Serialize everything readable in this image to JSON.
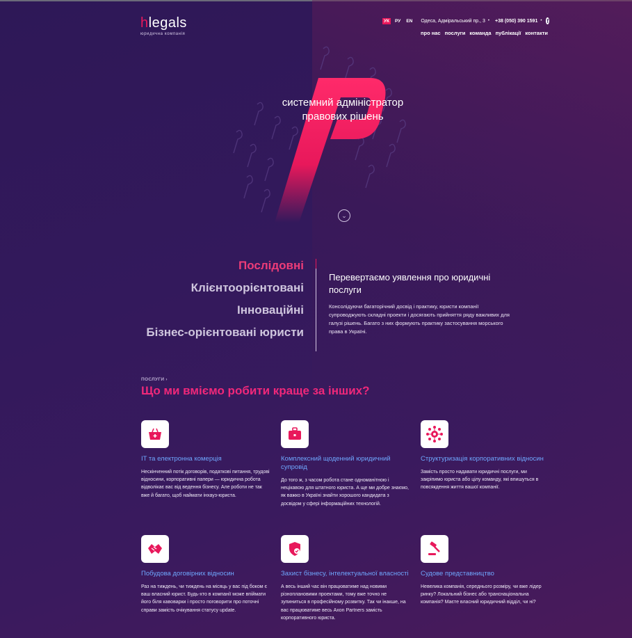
{
  "header": {
    "logo_h": "h",
    "logo_rest": "legals",
    "logo_sub": "юридична компанія",
    "languages": [
      "УК",
      "РУ",
      "EN"
    ],
    "address": "Одеса, Адміральський пр., 3",
    "phone": "+38 (050) 390 1591",
    "social_icon": "facebook-icon",
    "nav": [
      "про нас",
      "послуги",
      "команда",
      "публікації",
      "контакти"
    ]
  },
  "hero": {
    "title_line1": "системний адміністратор",
    "title_line2": "правових рішень",
    "scroll_icon": "chevron-down-icon"
  },
  "about": {
    "values": [
      "Послідовні",
      "Клієнтоорієнтовані",
      "Інноваційні",
      "Бізнес-орієнтовані юристи"
    ],
    "title": "Перевертаємо уявлення про юридичні послуги",
    "text": "Консолідуючи багаторічний досвід і практику, юристи компанії супроводжують складні проекти і досягають прийняття ряду важливих для галузі рішень. Багато з них формують практику застосування морського права в Україні."
  },
  "services": {
    "crumb": "ПОСЛУГИ ›",
    "title": "Що ми вміємо робити краще за інших?",
    "items": [
      {
        "icon": "shopping-basket-icon",
        "title": "IT та електронна комерція",
        "text": "Нескінченний потік договорів, податкові питання, трудові відносини, корпоративні папери — юридична робота відволікає вас від ведення бізнесу. Але роботи не так вже й багато, щоб наймати інхауз-юриста."
      },
      {
        "icon": "briefcase-icon",
        "title": "Комплексний щоденний юридичний супровід",
        "text": "До того ж, з часом робота стане одноманітною і нецікавою для штатного юриста. А ще ми добре знаємо, як важко в Україні знайти хорошого кандидата з досвідом у сфері інформаційних технологій."
      },
      {
        "icon": "network-icon",
        "title": "Структуризація корпоративних відносин",
        "text": "Замість просто надавати юридичні послуги, ми закріпимо юриста або цілу команду, які впишуться в повсякдення життя вашої компанії."
      },
      {
        "icon": "handshake-icon",
        "title": "Побудова договірних відносин",
        "text": "Раз на тиждень, чи тиждень на місяць у вас під боком є ваш власний юрист. Будь-хто в компанії може впіймати його біля кавоварки і просто поговорити про поточні справи замість очікування статусу update."
      },
      {
        "icon": "shield-check-icon",
        "title": "Захист бізнесу, інтелектуальної власності",
        "text": "А весь інший час він працюватиме над новими різноплановими проектами, тому вже точно не зупиниться в професійному розвитку. Так чи інакше, на вас працюватиме весь Axon Partners замість корпоративного юриста."
      },
      {
        "icon": "gavel-icon",
        "title": "Судове представництво",
        "text": "Невелика компанія, середнього розміру, чи вже лідер ринку? Локальний бізнес або транснаціональна компанія? Маєте власний юридичний відділ, чи ні?"
      }
    ]
  },
  "colors": {
    "accent": "#e8185b",
    "link": "#6fa8ff",
    "bg": "#32195b"
  }
}
